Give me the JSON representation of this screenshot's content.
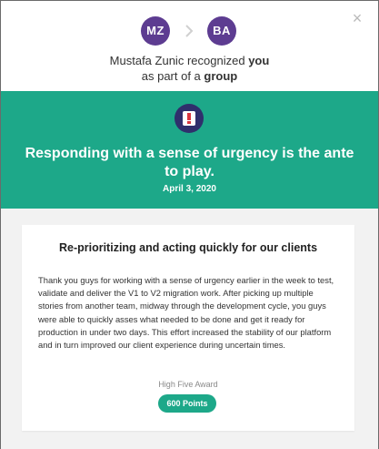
{
  "header": {
    "close_glyph": "×",
    "sender_initials": "MZ",
    "recipient_initials": "BA",
    "avatar_color": "#5d3c91",
    "sender_name": "Mustafa Zunic",
    "recognized_text": "recognized",
    "recipient_text": "you",
    "line2_prefix": "as part of a",
    "line2_group": "group"
  },
  "banner": {
    "color": "#1da889",
    "icon": "alert-badge-icon",
    "headline": "Responding with a sense of urgency is the ante to play.",
    "date": "April 3, 2020"
  },
  "card": {
    "title": "Re-prioritizing and acting quickly for our clients",
    "body": "Thank you guys for working with a sense of urgency earlier in the week to test, validate and deliver the V1 to V2 migration work. After picking up multiple stories from another team, midway through the development cycle, you guys were able to quickly asses what needed to be done and get it ready for production in under two days. This effort increased the stability of our platform and in turn improved our client experience during uncertain times.",
    "award_label": "High Five Award",
    "points_label": "600 Points"
  }
}
